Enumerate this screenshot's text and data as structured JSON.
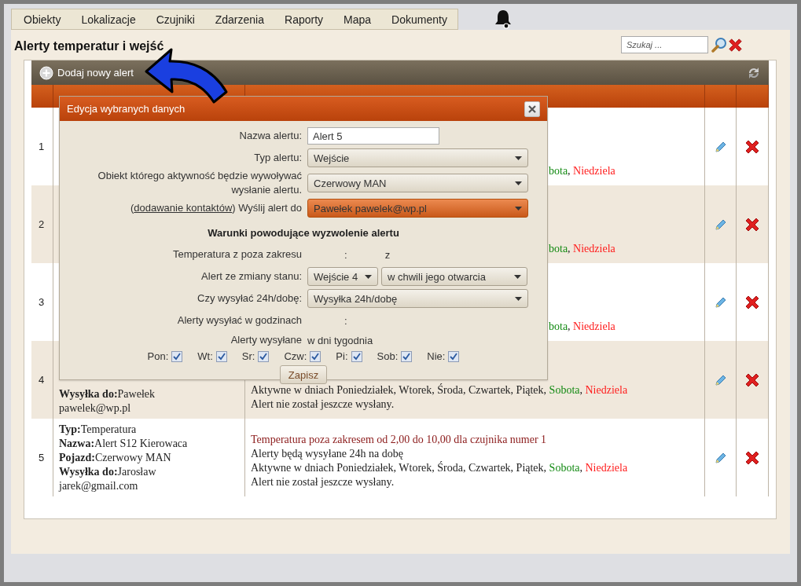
{
  "menu": [
    {
      "label": "Obiekty"
    },
    {
      "label": "Lokalizacje"
    },
    {
      "label": "Czujniki"
    },
    {
      "label": "Zdarzenia"
    },
    {
      "label": "Raporty"
    },
    {
      "label": "Mapa"
    },
    {
      "label": "Dokumenty"
    }
  ],
  "page_title": "Alerty temperatur i wejść",
  "search": {
    "placeholder": "Szukaj ..."
  },
  "toolbar": {
    "add_label": "Dodaj nowy alert"
  },
  "rows": [
    {
      "number": "1",
      "details": [],
      "conditions": [
        {
          "kind": "partial",
          "segments": [
            {
              "text": "bota",
              "color": "#138a13"
            },
            {
              "text": ", "
            },
            {
              "text": "Niedziela",
              "color": "#ff1a1a"
            }
          ]
        }
      ]
    },
    {
      "number": "2",
      "details": [],
      "conditions": [
        {
          "kind": "partial",
          "segments": [
            {
              "text": "bota",
              "color": "#138a13"
            },
            {
              "text": ", "
            },
            {
              "text": "Niedziela",
              "color": "#ff1a1a"
            }
          ]
        }
      ]
    },
    {
      "number": "3",
      "details": [],
      "conditions": [
        {
          "kind": "partial",
          "segments": [
            {
              "text": "bota",
              "color": "#138a13"
            },
            {
              "text": ", "
            },
            {
              "text": "Niedziela",
              "color": "#ff1a1a"
            }
          ]
        }
      ]
    },
    {
      "number": "4",
      "details": [
        "**Wysyłka do:**Pawełek",
        "pawelek@wp.pl"
      ],
      "conditions": [
        {
          "kind": "full",
          "segments": [
            {
              "text": "Aktywne w dniach Poniedziałek, Wtorek, Środa, Czwartek, Piątek, "
            },
            {
              "text": "Sobota",
              "color": "#138a13"
            },
            {
              "text": ", "
            },
            {
              "text": "Niedziela",
              "color": "#ff1a1a"
            }
          ]
        },
        {
          "kind": "full",
          "segments": [
            {
              "text": "Alert nie został jeszcze wysłany."
            }
          ]
        }
      ]
    },
    {
      "number": "5",
      "details": [
        "**Typ:**Temperatura",
        "**Nazwa:**Alert S12 Kierowaca",
        "**Pojazd:**Czerwowy MAN",
        "**Wysyłka do:**Jarosław",
        "jarek@gmail.com"
      ],
      "conditions": [
        {
          "kind": "full",
          "segments": [
            {
              "text": "Temperatura poza zakresem od 2,00 do 10,00 dla czujnika numer 1",
              "color": "#8b1a1a"
            }
          ]
        },
        {
          "kind": "full",
          "segments": [
            {
              "text": "Alerty będą wysyłane 24h na dobę"
            }
          ]
        },
        {
          "kind": "full",
          "segments": [
            {
              "text": "Aktywne w dniach Poniedziałek, Wtorek, Środa, Czwartek, Piątek, "
            },
            {
              "text": "Sobota",
              "color": "#138a13"
            },
            {
              "text": ", "
            },
            {
              "text": "Niedziela",
              "color": "#ff1a1a"
            }
          ]
        },
        {
          "kind": "full",
          "segments": [
            {
              "text": "Alert nie został jeszcze wysłany."
            }
          ]
        }
      ]
    }
  ],
  "dialog": {
    "title": "Edycja wybranych danych",
    "fields": [
      {
        "kind": "input",
        "label": "Nazwa alertu:",
        "value": "Alert 5"
      },
      {
        "kind": "select",
        "label": "Typ alertu:",
        "value": "Wejście",
        "highlighted": false
      },
      {
        "kind": "select",
        "label": "Obiekt którego aktywność będzie wywoływać wysłanie alertu.",
        "value": "Czerwowy MAN",
        "highlighted": false
      },
      {
        "kind": "select",
        "open": "(",
        "link": "dodawanie kontaktów",
        "label": ") Wyślij alert do",
        "value": "Pawełek pawelek@wp.pl",
        "highlighted": true
      },
      {
        "kind": "heading",
        "label": "Warunki powodujące wyzwolenie alertu"
      },
      {
        "kind": "range",
        "label": "Temperatura z poza zakresu",
        "parts": [
          ":",
          "z"
        ]
      },
      {
        "kind": "selects",
        "label": "Alert ze zmiany stanu:",
        "values": [
          "Wejście 4",
          "w chwili jego otwarcia"
        ]
      },
      {
        "kind": "select",
        "label": "Czy wysyłać 24h/dobę:",
        "value": "Wysyłka 24h/dobę",
        "highlighted": false
      },
      {
        "kind": "range",
        "label": "Alerty wysyłać w godzinach",
        "parts": [
          ":"
        ]
      },
      {
        "kind": "note",
        "label": "Alerty wysyłane",
        "value": "w dni tygodnia"
      }
    ],
    "days": [
      {
        "label": "Pon:",
        "checked": true
      },
      {
        "label": "Wt:",
        "checked": true
      },
      {
        "label": "Sr:",
        "checked": true
      },
      {
        "label": "Czw:",
        "checked": true
      },
      {
        "label": "Pi:",
        "checked": true
      },
      {
        "label": "Sob:",
        "checked": true
      },
      {
        "label": "Nie:",
        "checked": true
      }
    ],
    "save": "Zapisz"
  }
}
